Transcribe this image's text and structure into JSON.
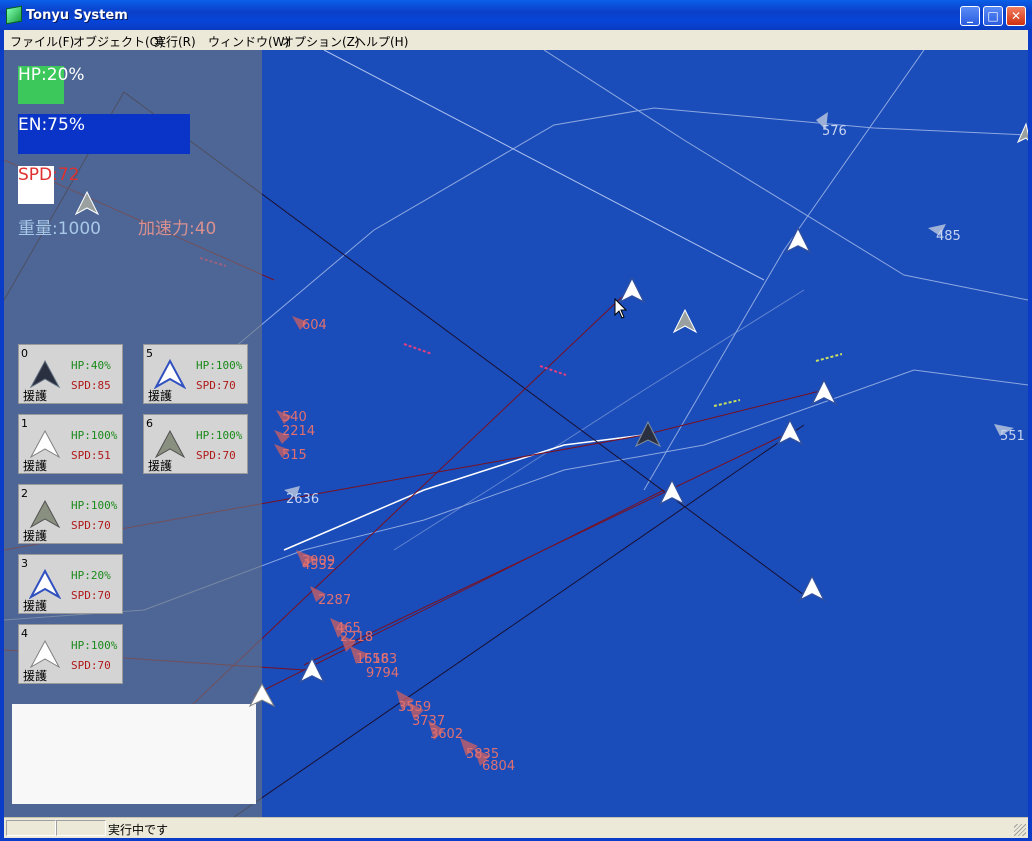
{
  "window": {
    "title": "Tonyu System",
    "minimize_glyph": "_",
    "maximize_glyph": "□",
    "close_glyph": "✕"
  },
  "menu": [
    "ファイル(F)",
    "オブジェクト(O)",
    "実行(R)",
    "ウィンドウ(W)",
    "オプション(Z)",
    "ヘルプ(H)"
  ],
  "hud": {
    "hp_label": "HP:20%",
    "hp_value": 0.2,
    "en_label": "EN:75%",
    "en_value": 0.75,
    "spd_label": "SPD:72",
    "weight_label": "重量:1000",
    "accel_label": "加速力:40",
    "colors": {
      "hp": "#3cc85a",
      "en": "#0a34c8",
      "spd_text": "#e03030",
      "weight_text": "#a8c8e8",
      "accel_text": "#d89090"
    }
  },
  "units": [
    {
      "num": "0",
      "hp": "HP:40%",
      "spd": "SPD:85",
      "tag": "援護",
      "icon": "dark-fighter-icon"
    },
    {
      "num": "1",
      "hp": "HP:100%",
      "spd": "SPD:51",
      "tag": "援護",
      "icon": "white-fighter-icon"
    },
    {
      "num": "2",
      "hp": "HP:100%",
      "spd": "SPD:70",
      "tag": "援護",
      "icon": "gray-fighter-icon"
    },
    {
      "num": "3",
      "hp": "HP:20%",
      "spd": "SPD:70",
      "tag": "援護",
      "icon": "blue-fighter-icon"
    },
    {
      "num": "4",
      "hp": "HP:100%",
      "spd": "SPD:70",
      "tag": "援護",
      "icon": "white-fighter-icon"
    },
    {
      "num": "5",
      "hp": "HP:100%",
      "spd": "SPD:70",
      "tag": "援護",
      "icon": "blue-fighter-icon"
    },
    {
      "num": "6",
      "hp": "HP:100%",
      "spd": "SPD:70",
      "tag": "援護",
      "icon": "gray-fighter-icon"
    }
  ],
  "scene_numbers": {
    "n576": "576",
    "n485": "485",
    "n551": "551",
    "n604": "604",
    "n540": "540",
    "n2214": "2214",
    "n515": "515",
    "n2636": "2636",
    "n4532": "4532",
    "n3909": "3909",
    "n2287": "2287",
    "n465": "465",
    "n2218": "2218",
    "n1516": "1516",
    "n6583": "6583",
    "n9794": "9794",
    "n3559": "3559",
    "n3737": "3737",
    "n3602": "3602",
    "n5835": "5835",
    "n6804": "6804"
  },
  "status": {
    "text": "実行中です"
  }
}
